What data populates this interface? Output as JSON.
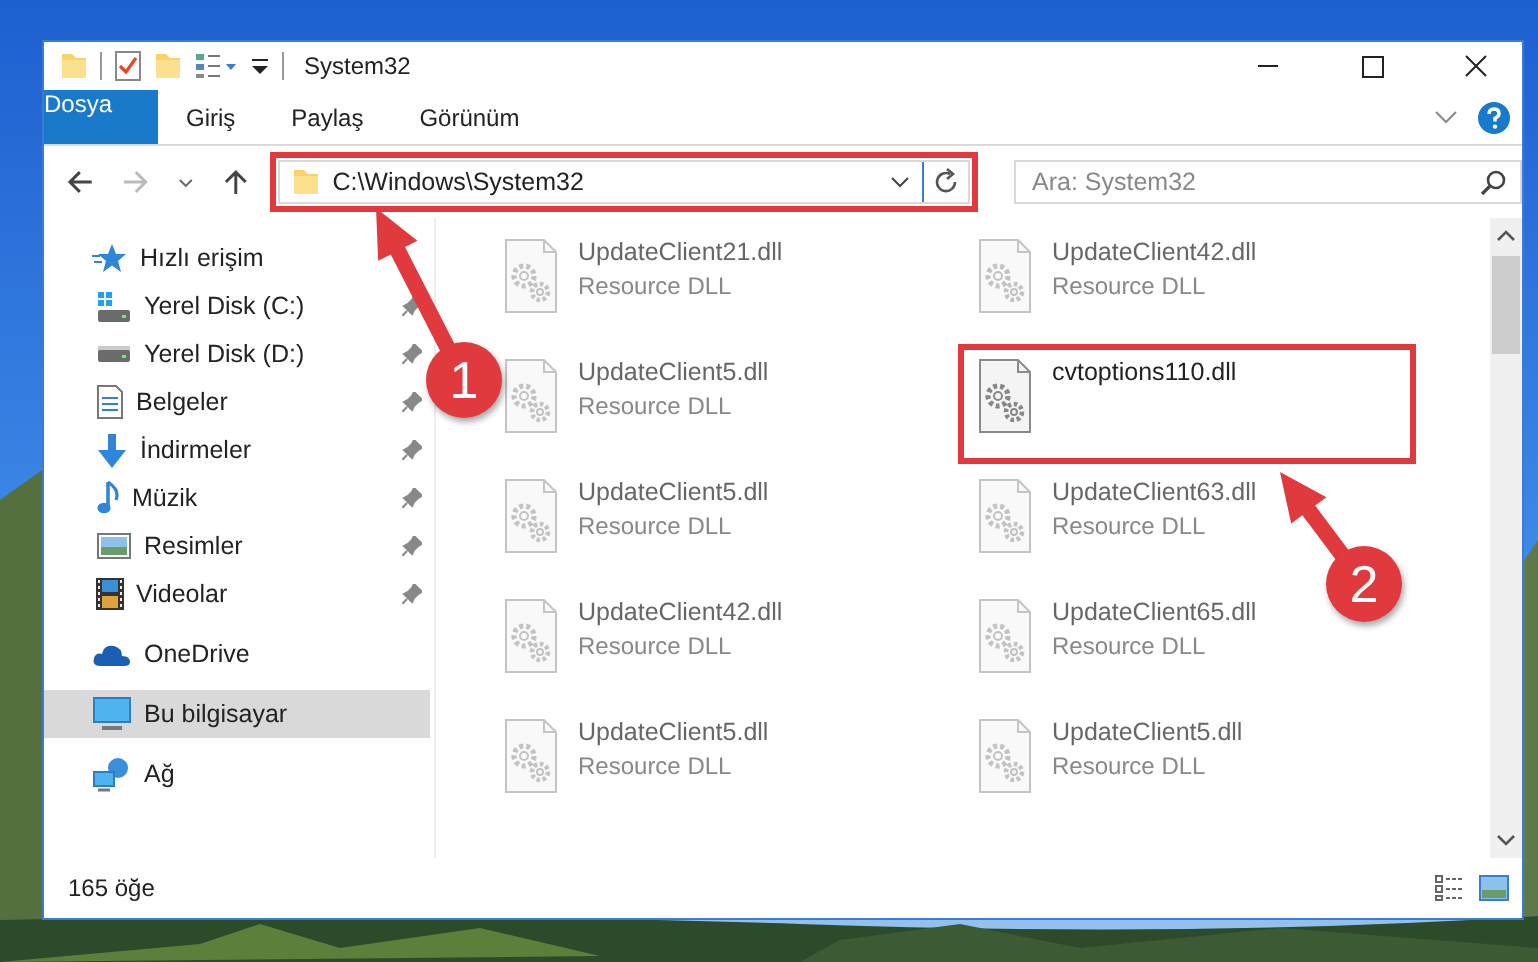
{
  "window": {
    "title": "System32"
  },
  "ribbon_tabs": [
    {
      "label": "Dosya",
      "kind": "file",
      "selected": false
    },
    {
      "label": "Giriş",
      "kind": "tab",
      "selected": false
    },
    {
      "label": "Paylaş",
      "kind": "tab",
      "selected": false
    },
    {
      "label": "Görünüm",
      "kind": "tab",
      "selected": false
    }
  ],
  "address_bar": {
    "path": "C:\\Windows\\System32",
    "highlighted": true
  },
  "search": {
    "placeholder": "Ara: System32"
  },
  "sidebar": {
    "items": [
      {
        "label": "Hızlı erişim",
        "selected": false,
        "children": [
          {
            "label": "Yerel Disk (C:)",
            "pinned": true,
            "selected": false
          },
          {
            "label": "Yerel Disk (D:)",
            "pinned": true,
            "selected": false
          },
          {
            "label": "Belgeler",
            "pinned": true,
            "selected": false
          },
          {
            "label": "İndirmeler",
            "pinned": true,
            "selected": false
          },
          {
            "label": "Müzik",
            "pinned": true,
            "selected": false
          },
          {
            "label": "Resimler",
            "pinned": true,
            "selected": false
          },
          {
            "label": "Videolar",
            "pinned": true,
            "selected": false
          }
        ]
      },
      {
        "label": "OneDrive",
        "selected": false
      },
      {
        "label": "Bu bilgisayar",
        "selected": true
      },
      {
        "label": "Ağ",
        "selected": false
      }
    ]
  },
  "files": [
    {
      "name": "UpdateClient21.dll",
      "type": "Resource DLL",
      "dimmed": true,
      "highlighted": false
    },
    {
      "name": "UpdateClient42.dll",
      "type": "Resource DLL",
      "dimmed": true,
      "highlighted": false
    },
    {
      "name": "UpdateClient5.dll",
      "type": "Resource DLL",
      "dimmed": true,
      "highlighted": false
    },
    {
      "name": "cvtoptions110.dll",
      "dimmed": false,
      "highlighted": true
    },
    {
      "name": "UpdateClient5.dll",
      "type": "Resource DLL",
      "dimmed": true,
      "highlighted": false
    },
    {
      "name": "UpdateClient63.dll",
      "type": "Resource DLL",
      "dimmed": true,
      "highlighted": false
    },
    {
      "name": "UpdateClient42.dll",
      "type": "Resource DLL",
      "dimmed": true,
      "highlighted": false
    },
    {
      "name": "UpdateClient65.dll",
      "type": "Resource DLL",
      "dimmed": true,
      "highlighted": false
    },
    {
      "name": "UpdateClient5.dll",
      "type": "Resource DLL",
      "dimmed": true,
      "highlighted": false
    },
    {
      "name": "UpdateClient5.dll",
      "type": "Resource DLL",
      "dimmed": true,
      "highlighted": false
    }
  ],
  "status_bar": {
    "item_count": "165 öğe"
  },
  "annotations": [
    {
      "label": "1"
    },
    {
      "label": "2"
    }
  ]
}
